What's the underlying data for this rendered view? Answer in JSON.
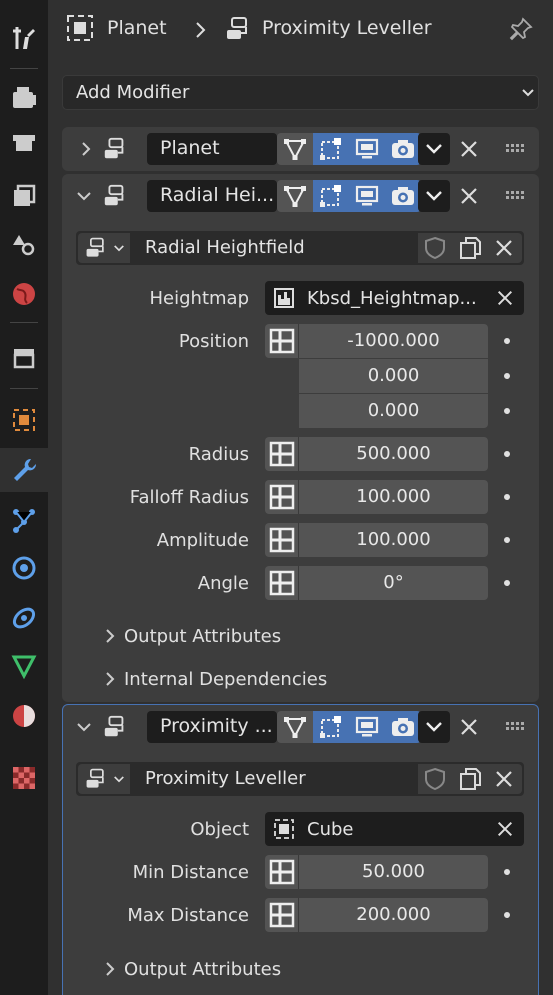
{
  "header": {
    "object_name": "Planet",
    "modifier_name": "Proximity Leveller"
  },
  "add_modifier": {
    "label": "Add Modifier"
  },
  "collapsed_modifier": {
    "name": "Planet"
  },
  "radial_modifier": {
    "header_name": "Radial Hei...",
    "node_group": "Radial Heightfield",
    "fields": {
      "heightmap_label": "Heightmap",
      "heightmap_value": "Kbsd_Heightmap...",
      "position_label": "Position",
      "position_x": "-1000.000",
      "position_y": "0.000",
      "position_z": "0.000",
      "radius_label": "Radius",
      "radius_value": "500.000",
      "falloff_label": "Falloff Radius",
      "falloff_value": "100.000",
      "amplitude_label": "Amplitude",
      "amplitude_value": "100.000",
      "angle_label": "Angle",
      "angle_value": "0°"
    },
    "subpanels": {
      "output": "Output Attributes",
      "internal": "Internal Dependencies"
    }
  },
  "proximity_modifier": {
    "header_name": "Proximity ...",
    "node_group": "Proximity Leveller",
    "fields": {
      "object_label": "Object",
      "object_value": "Cube",
      "min_label": "Min Distance",
      "min_value": "50.000",
      "max_label": "Max Distance",
      "max_value": "200.000"
    },
    "subpanels": {
      "output": "Output Attributes"
    }
  }
}
